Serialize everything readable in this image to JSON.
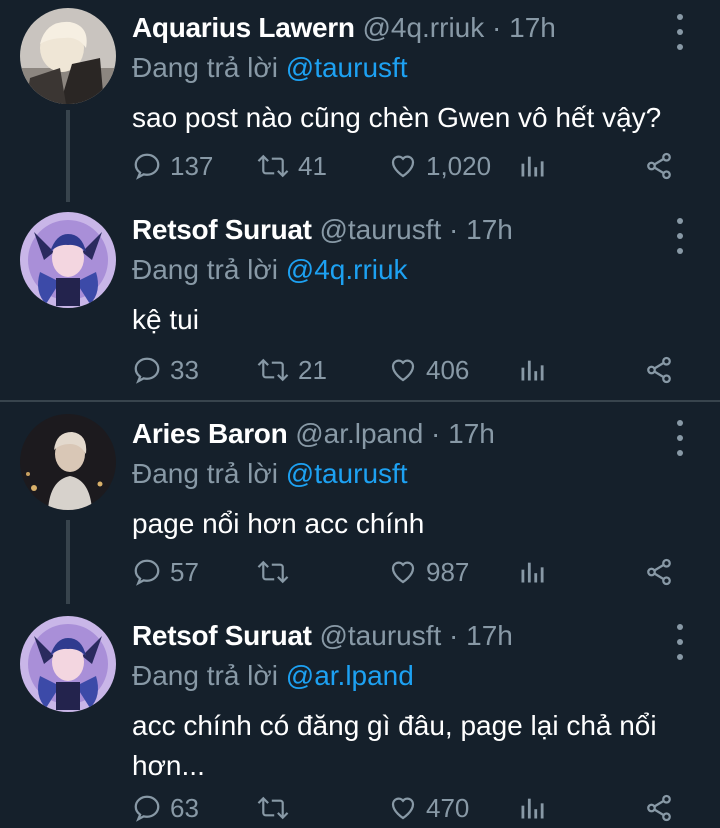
{
  "colors": {
    "background": "#15202b",
    "muted": "#8899a6",
    "mention": "#1da1f2",
    "divider": "#38444d"
  },
  "tweets": [
    {
      "name": "Aquarius Lawern",
      "handle_time": "@4q.rriuk · 17h",
      "reply_prefix": "Đang trả lời",
      "reply_to": "@taurusft",
      "text": "sao post nào cũng chèn Gwen vô hết vậy?",
      "reply_count": "137",
      "retweet_count": "41",
      "like_count": "1,020"
    },
    {
      "name": "Retsof Suruat",
      "handle_time": "@taurusft · 17h",
      "reply_prefix": "Đang trả lời",
      "reply_to": "@4q.rriuk",
      "text": "kệ tui",
      "reply_count": "33",
      "retweet_count": "21",
      "like_count": "406"
    },
    {
      "name": "Aries Baron",
      "handle_time": "@ar.lpand · 17h",
      "reply_prefix": "Đang trả lời",
      "reply_to": "@taurusft",
      "text": "page nổi hơn acc chính",
      "reply_count": "57",
      "retweet_count": "",
      "like_count": "987"
    },
    {
      "name": "Retsof Suruat",
      "handle_time": "@taurusft · 17h",
      "reply_prefix": "Đang trả lời",
      "reply_to": "@ar.lpand",
      "text": "acc chính có đăng gì đâu, page lại chả nổi hơn...",
      "reply_count": "63",
      "retweet_count": "",
      "like_count": "470"
    }
  ],
  "icons": {
    "reply": "reply-icon",
    "retweet": "retweet-icon",
    "like": "heart-icon",
    "analytics": "analytics-icon",
    "share": "share-icon",
    "more": "more-vertical-icon"
  }
}
